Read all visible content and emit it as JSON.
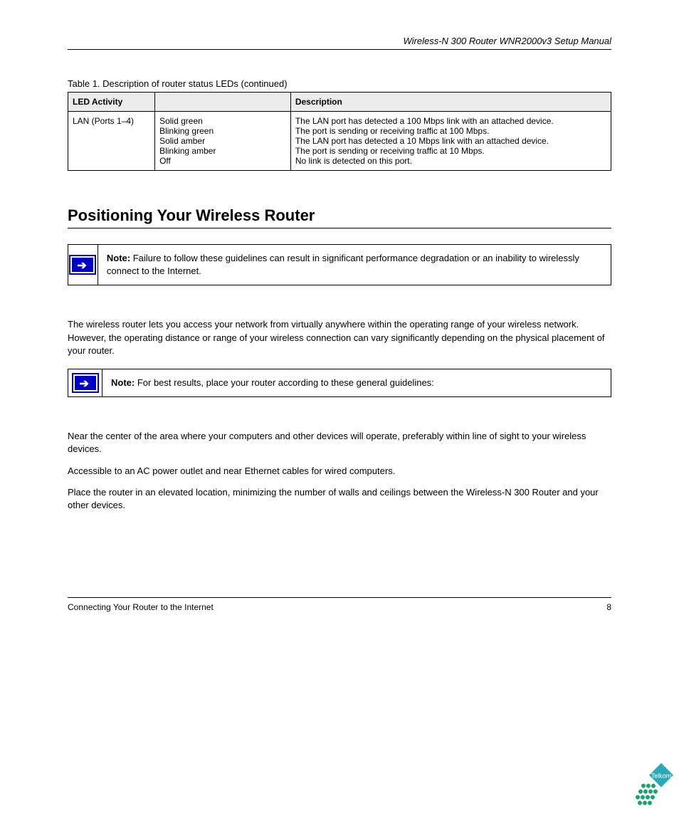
{
  "header": {
    "title": "Wireless-N 300 Router WNR2000v3 Setup Manual"
  },
  "table": {
    "caption": "Table 1.  Description of router status LEDs (continued)",
    "columns": [
      "LED Activity",
      "",
      "Description"
    ],
    "row": {
      "led": "LAN (Ports 1–4)",
      "states": [
        {
          "activity": "Solid green",
          "desc": "The LAN port has detected a 100 Mbps link with an attached device."
        },
        {
          "activity": "Blinking green",
          "desc": "The port is sending or receiving traffic at 100 Mbps."
        },
        {
          "activity": "Solid amber",
          "desc": "The LAN port has detected a 10 Mbps link with an attached device."
        },
        {
          "activity": "Blinking amber",
          "desc": "The port is sending or receiving traffic at 10 Mbps."
        },
        {
          "activity": "Off",
          "desc": "No link is detected on this port."
        }
      ]
    }
  },
  "section": {
    "title": "Positioning Your Wireless Router"
  },
  "note1": {
    "label": "Note:",
    "text": " Failure to follow these guidelines can result in significant performance degradation or an inability to wirelessly connect to the Internet."
  },
  "para1": "The wireless router lets you access your network from virtually anywhere within the operating range of your wireless network. However, the operating distance or range of your wireless connection can vary significantly depending on the physical placement of your router.",
  "note2": {
    "label": "Note:",
    "text": " For best results, place your router according to these general guidelines:"
  },
  "paras": [
    "Near the center of the area where your computers and other devices will operate, preferably within line of sight to your wireless devices.",
    "Accessible to an AC power outlet and near Ethernet cables for wired computers.",
    "Place the router in an elevated location, minimizing the number of walls and ceilings between the Wireless-N 300 Router and your other devices."
  ],
  "footer": {
    "left": "Connecting Your Router to the Internet",
    "right": "8"
  },
  "logo_text": "Telkom"
}
